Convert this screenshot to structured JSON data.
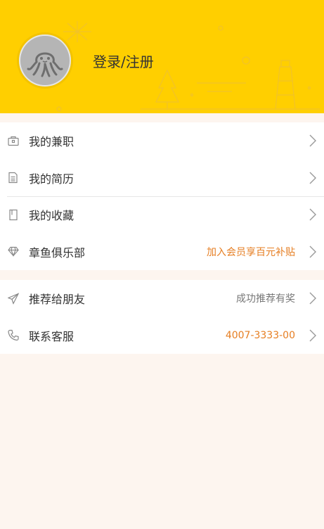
{
  "header": {
    "login_label": "登录/注册",
    "background_color": "#ffcf00",
    "avatar_icon": "octopus-icon"
  },
  "menu_group_1": [
    {
      "label": "我的兼职",
      "icon": "briefcase-icon",
      "extra": ""
    },
    {
      "label": "我的简历",
      "icon": "document-icon",
      "extra": ""
    },
    {
      "label": "我的收藏",
      "icon": "bookmark-icon",
      "extra": ""
    },
    {
      "label": "章鱼俱乐部",
      "icon": "diamond-icon",
      "extra": "加入会员享百元补贴"
    }
  ],
  "menu_group_2": [
    {
      "label": "推荐给朋友",
      "icon": "send-icon",
      "extra": "成功推荐有奖"
    },
    {
      "label": "联系客服",
      "icon": "phone-icon",
      "extra": "4007-3333-00"
    }
  ],
  "colors": {
    "accent": "#e67e22",
    "page_background": "#fdf5ef"
  }
}
